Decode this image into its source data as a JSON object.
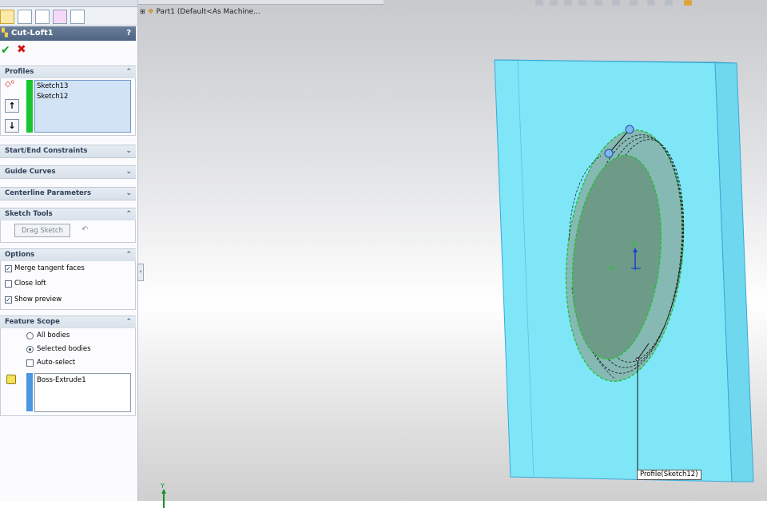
{
  "panel": {
    "title": "Cut-Loft1",
    "help": "?",
    "groups": {
      "profiles": {
        "label": "Profiles",
        "items": [
          "Sketch13",
          "Sketch12"
        ]
      },
      "start_end": {
        "label": "Start/End Constraints"
      },
      "guide": {
        "label": "Guide Curves"
      },
      "centerline": {
        "label": "Centerline Parameters"
      },
      "sketch_tools": {
        "label": "Sketch Tools",
        "drag_button": "Drag Sketch"
      },
      "options": {
        "label": "Options",
        "items": [
          {
            "label": "Merge tangent faces",
            "checked": true
          },
          {
            "label": "Close loft",
            "checked": false
          },
          {
            "label": "Show preview",
            "checked": true
          }
        ]
      },
      "feature_scope": {
        "label": "Feature Scope",
        "radio_all": "All bodies",
        "radio_selected": "Selected bodies",
        "selected": "Selected bodies",
        "auto_select": "Auto-select",
        "auto_checked": false,
        "bodies": [
          "Boss-Extrude1"
        ]
      }
    }
  },
  "viewport": {
    "tree_label": "Part1  (Default<As Machine...",
    "callout": "Profile(Sketch12)",
    "triad_label": "Y"
  },
  "colors": {
    "part_face": "#7fe6f8",
    "profile_green": "#19c530",
    "scope_blue": "#4b97e2",
    "preview_fill": "#6e9a88"
  }
}
